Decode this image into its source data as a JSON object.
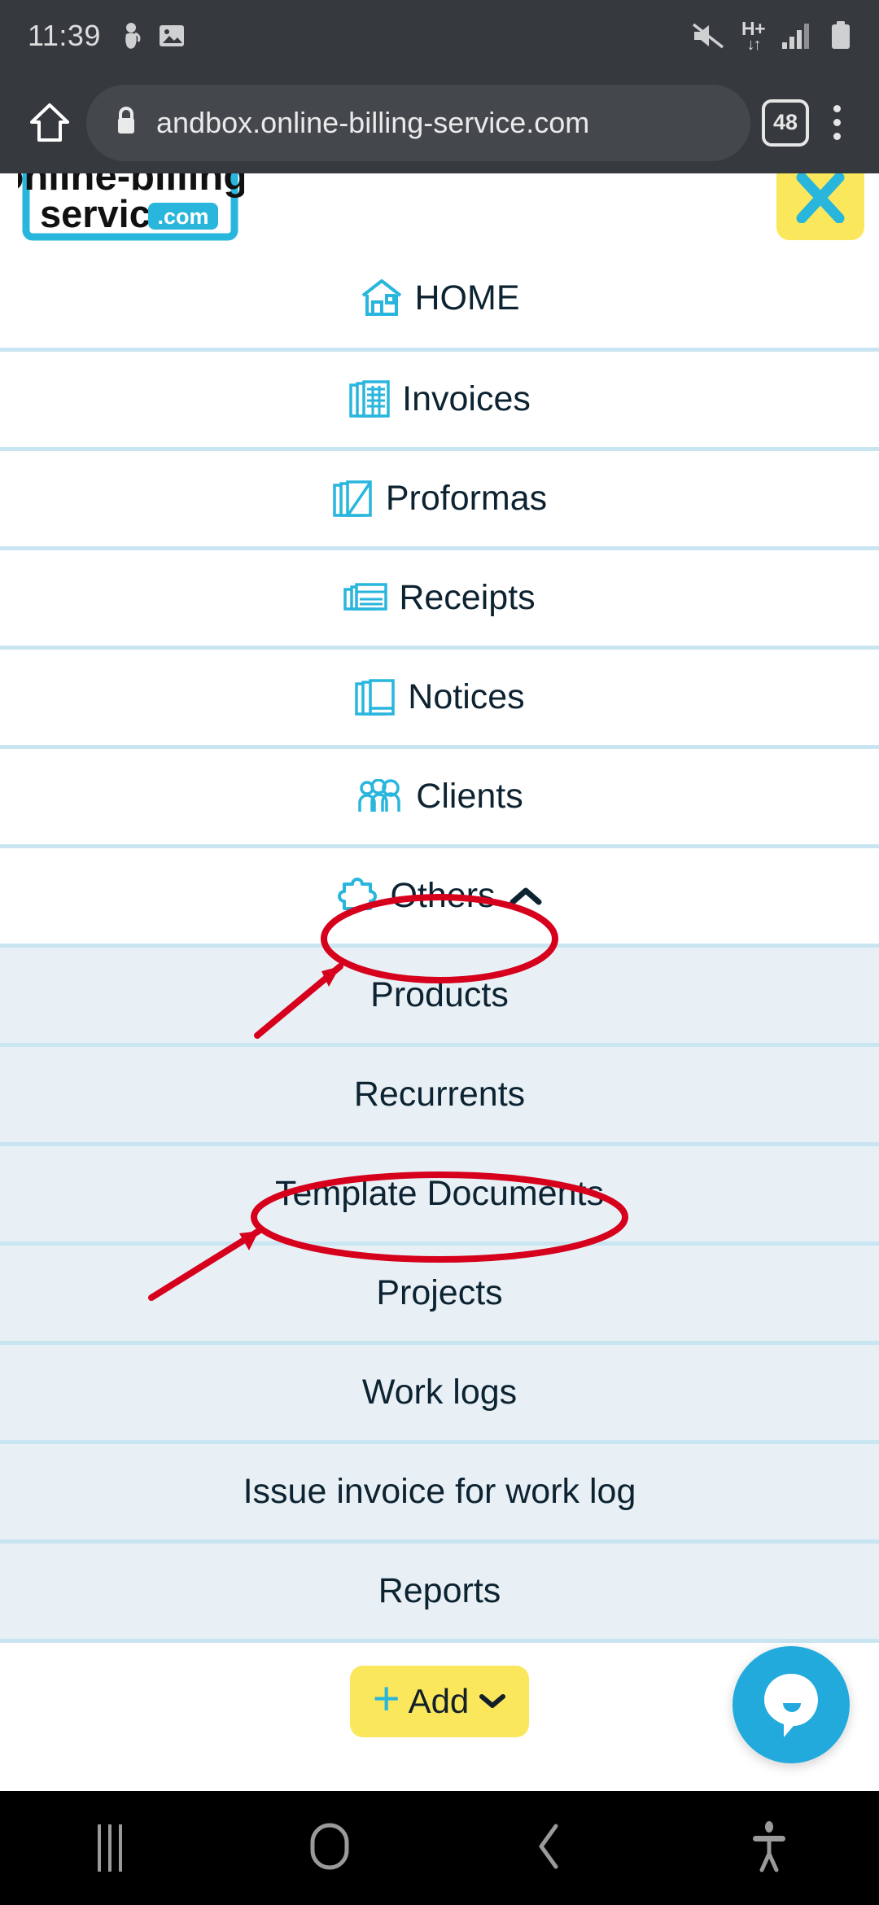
{
  "status_bar": {
    "time": "11:39",
    "left_icons": [
      "scuba-diver-icon",
      "image-icon"
    ],
    "right_icons": [
      "mute-icon",
      "hplus-network-icon",
      "signal-icon",
      "battery-icon"
    ],
    "network_label": "H+",
    "network_arrows": "↓↑"
  },
  "browser": {
    "home_icon": "home-icon",
    "lock_icon": "lock-icon",
    "url": "andbox.online-billing-service.com",
    "tab_count": "48",
    "menu_icon": "kebab-menu-icon"
  },
  "site": {
    "logo_line1": "online-billing-",
    "logo_line2": "service",
    "logo_tld": ".com",
    "close_label": "✕",
    "brand_cyan": "#29b6dd",
    "brand_yellow": "#fbe75c",
    "separator_color": "#c9e5f2",
    "submenu_bg": "#e8f0f6"
  },
  "menu": {
    "items": [
      {
        "label": "HOME",
        "icon": "house-icon",
        "sub": false,
        "expanded": null
      },
      {
        "label": "Invoices",
        "icon": "invoices-icon",
        "sub": false,
        "expanded": null
      },
      {
        "label": "Proformas",
        "icon": "proformas-icon",
        "sub": false,
        "expanded": null
      },
      {
        "label": "Receipts",
        "icon": "receipts-icon",
        "sub": false,
        "expanded": null
      },
      {
        "label": "Notices",
        "icon": "notices-icon",
        "sub": false,
        "expanded": null
      },
      {
        "label": "Clients",
        "icon": "clients-icon",
        "sub": false,
        "expanded": null
      },
      {
        "label": "Others",
        "icon": "puzzle-icon",
        "sub": false,
        "expanded": true
      },
      {
        "label": "Products",
        "icon": null,
        "sub": true,
        "expanded": null
      },
      {
        "label": "Recurrents",
        "icon": null,
        "sub": true,
        "expanded": null
      },
      {
        "label": "Template Documents",
        "icon": null,
        "sub": true,
        "expanded": null
      },
      {
        "label": "Projects",
        "icon": null,
        "sub": true,
        "expanded": null
      },
      {
        "label": "Work logs",
        "icon": null,
        "sub": true,
        "expanded": null
      },
      {
        "label": "Issue invoice for work log",
        "icon": null,
        "sub": true,
        "expanded": null
      },
      {
        "label": "Reports",
        "icon": null,
        "sub": true,
        "expanded": null
      }
    ]
  },
  "footer": {
    "add_plus": "+",
    "add_label": "Add",
    "add_chevron": "⌄",
    "chat_icon": "chat-bubble-icon"
  },
  "annotations": {
    "highlight_color": "#d6001c",
    "circled": [
      "Others",
      "Template Documents"
    ],
    "arrows": 2
  },
  "navbar": {
    "items": [
      {
        "name": "recents-button",
        "icon": "recents-icon"
      },
      {
        "name": "home-button",
        "icon": "home-square-icon"
      },
      {
        "name": "back-button",
        "icon": "back-chevron-icon"
      },
      {
        "name": "accessibility-button",
        "icon": "accessibility-icon"
      }
    ]
  }
}
